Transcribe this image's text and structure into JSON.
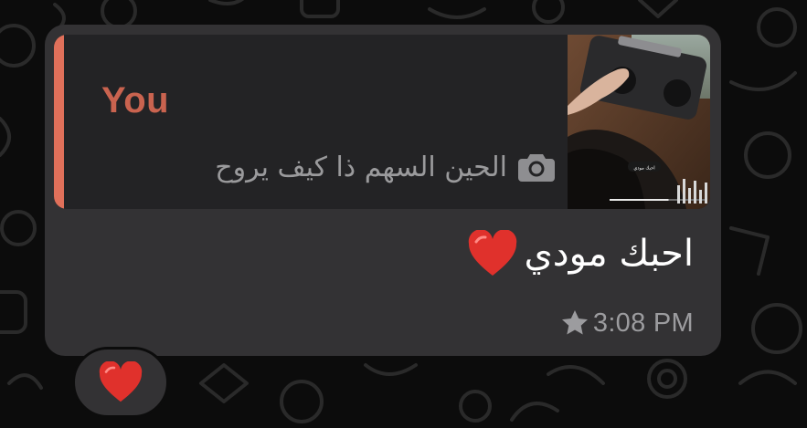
{
  "message": {
    "reply": {
      "author": "You",
      "preview_text": "الحين السهم ذا كيف يروح",
      "preview_icon": "camera-icon",
      "thumbnail": {
        "caption": "احبك مودي",
        "progress": 0.62
      }
    },
    "text": "احبك مودي",
    "emoji": "heart-emoji",
    "status_icon": "star-icon",
    "time": "3:08 PM",
    "reaction": "heart-emoji"
  },
  "colors": {
    "background": "#0c0c0c",
    "bubble": "#333234",
    "quote_bg": "#232325",
    "quote_bar": "#e0705a",
    "author": "#c9634f",
    "heart": "#e0312c"
  }
}
